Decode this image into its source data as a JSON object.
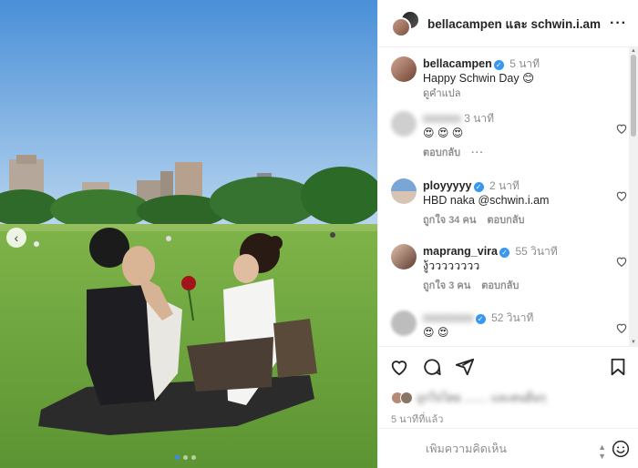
{
  "post": {
    "header": {
      "title": "bellacampen และ schwin.i.am",
      "more_label": "···"
    },
    "comments": [
      {
        "user": "bellacampen",
        "verified": true,
        "time": "5 นาที",
        "text": "Happy Schwin Day 😊",
        "translate": "ดูคำแปล"
      },
      {
        "user": "blur",
        "verified": false,
        "time": "3 นาที",
        "text": "😍 😍 😍",
        "reply": "ตอบกลับ",
        "more": "···"
      },
      {
        "user": "ployyyyy",
        "verified": true,
        "time": "2 นาที",
        "text": "HBD naka ",
        "mention": "@schwin.i.am",
        "likes": "ถูกใจ 34 คน",
        "reply": "ตอบกลับ"
      },
      {
        "user": "maprang_vira",
        "verified": true,
        "time": "55 วินาที",
        "text": "งู้วววววววว",
        "likes": "ถูกใจ 3 คน",
        "reply": "ตอบกลับ"
      },
      {
        "user": "blur",
        "verified": true,
        "time": "52 วินาที",
        "text": "😍 😍"
      }
    ],
    "time_ago": "5 นาทีที่แล้ว",
    "liked_by_blurred": "ถูกใจโดย ........ และคนอื่นๆ",
    "add_comment_placeholder": "เพิ่มความคิดเห็น",
    "sort_icon": "sort-icon",
    "nav_prev": "‹"
  }
}
